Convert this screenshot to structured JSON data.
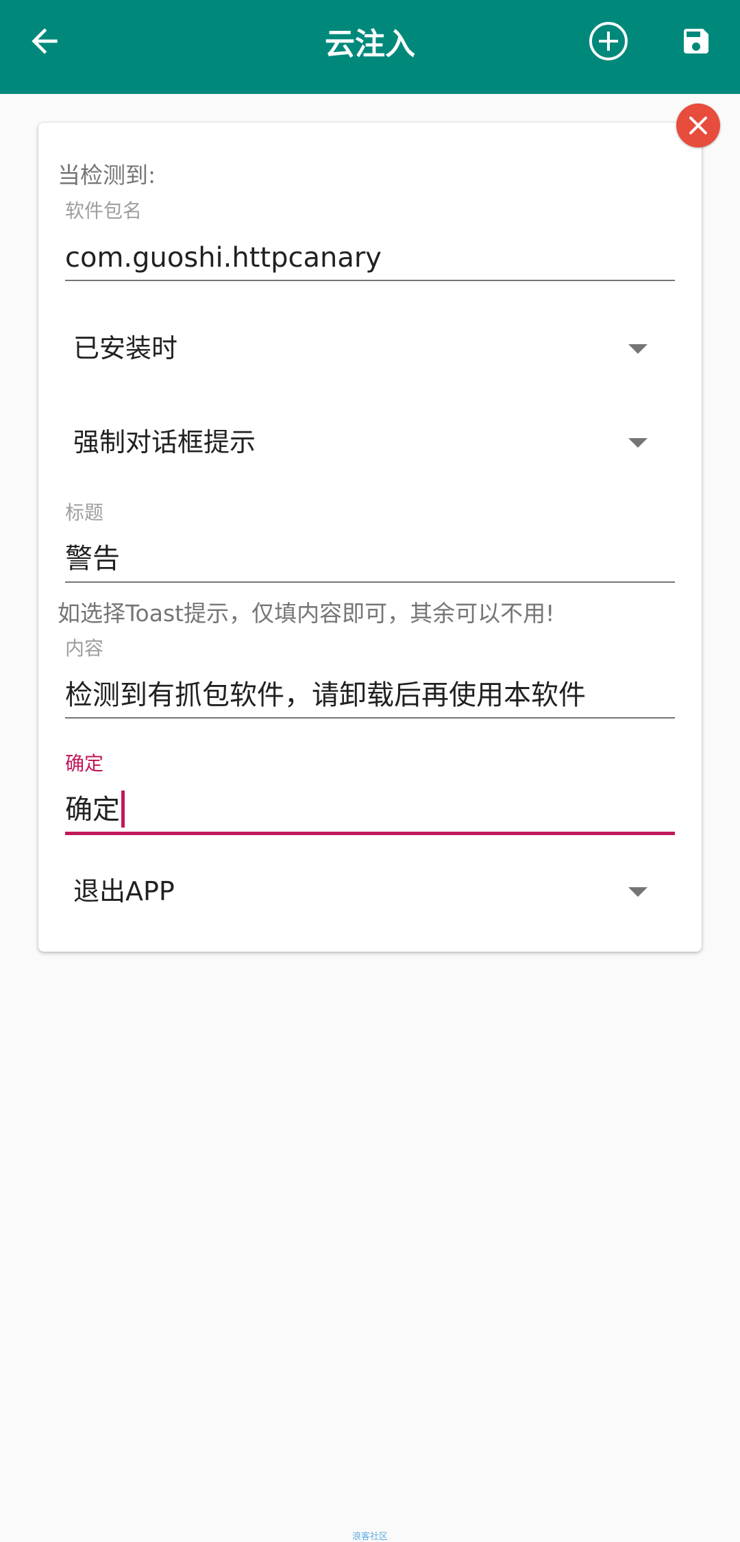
{
  "appbar": {
    "title": "云注入",
    "back_icon": "arrow-left-icon",
    "add_icon": "plus-circle-icon",
    "save_icon": "floppy-disk-icon",
    "color": "#00897b"
  },
  "card": {
    "close_icon": "close-icon",
    "section_label": "当检测到:",
    "package_field": {
      "label": "软件包名",
      "value": "com.guoshi.httpcanary"
    },
    "condition_spinner": {
      "selected": "已安装时"
    },
    "action_spinner": {
      "selected": "强制对话框提示"
    },
    "title_field": {
      "label": "标题",
      "value": "警告"
    },
    "hint": "如选择Toast提示，仅填内容即可，其余可以不用!",
    "content_field": {
      "label": "内容",
      "value": "检测到有抓包软件，请卸载后再使用本软件"
    },
    "confirm_field": {
      "label": "确定",
      "value": "确定"
    },
    "exit_spinner": {
      "selected": "退出APP"
    }
  },
  "colors": {
    "accent": "#c2185b",
    "close_button": "#e74c3c"
  },
  "watermark": "浪客社区"
}
